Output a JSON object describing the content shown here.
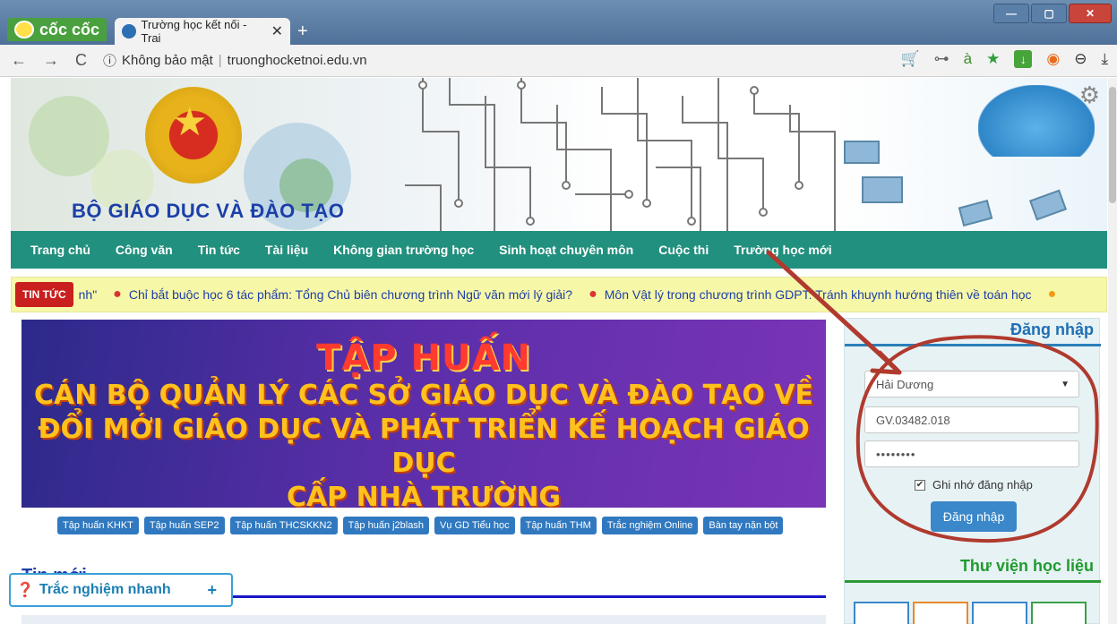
{
  "browser": {
    "brand": "cốc cốc",
    "tab_title": "Trường học kết nối - Trai",
    "tab_close": "✕",
    "new_tab": "+",
    "security_label": "Không bảo mật",
    "url": "truonghocketnoi.edu.vn"
  },
  "banner": {
    "title": "BỘ GIÁO DỤC VÀ ĐÀO TẠO"
  },
  "nav": {
    "items": [
      "Trang chủ",
      "Công văn",
      "Tin tức",
      "Tài liệu",
      "Không gian trường học",
      "Sinh hoạt chuyên môn",
      "Cuộc thi",
      "Trường học mới"
    ]
  },
  "ticker": {
    "label": "TIN TỨC",
    "items": [
      "nh\"",
      "Chỉ bắt buộc học 6 tác phẩm: Tổng Chủ biên chương trình Ngữ văn mới lý giải?",
      "Môn Vật lý trong chương trình GDPT: Tránh khuynh hướng thiên về toán học"
    ]
  },
  "hero": {
    "line1": "TẬP HUẤN",
    "line2": "CÁN BỘ QUẢN LÝ CÁC SỞ GIÁO DỤC VÀ ĐÀO TẠO VỀ",
    "line3": "ĐỔI MỚI GIÁO DỤC VÀ PHÁT TRIỂN KẾ HOẠCH GIÁO DỤC",
    "line4": "CẤP NHÀ TRƯỜNG"
  },
  "quick_links": [
    "Tập huấn KHKT",
    "Tập huấn SEP2",
    "Tập huấn THCSKKN2",
    "Tập huấn j2blash",
    "Vụ GD Tiểu học",
    "Tập huấn THM",
    "Trắc nghiệm Online",
    "Bàn tay nặn bột"
  ],
  "news": {
    "heading": "Tin mới"
  },
  "float_bar": {
    "label": "Trắc nghiệm nhanh",
    "plus": "+"
  },
  "login": {
    "title": "Đăng nhập",
    "province": "Hải Dương",
    "username": "GV.03482.018",
    "password": "••••••••",
    "remember_label": "Ghi nhớ đăng nhập",
    "remember_checked": true,
    "button": "Đăng nhập"
  },
  "library": {
    "title": "Thư viện học liệu"
  },
  "colors": {
    "nav_bg": "#22907e",
    "ticker_bg": "#f7f7a8",
    "ticker_label": "#c9201f",
    "login_button": "#3a87c9",
    "annotation": "#b03a2e"
  },
  "icons": {
    "back": "arrow-left-icon",
    "forward": "arrow-right-icon",
    "reload": "reload-icon",
    "info": "info-icon",
    "settings": "gear-icon"
  }
}
